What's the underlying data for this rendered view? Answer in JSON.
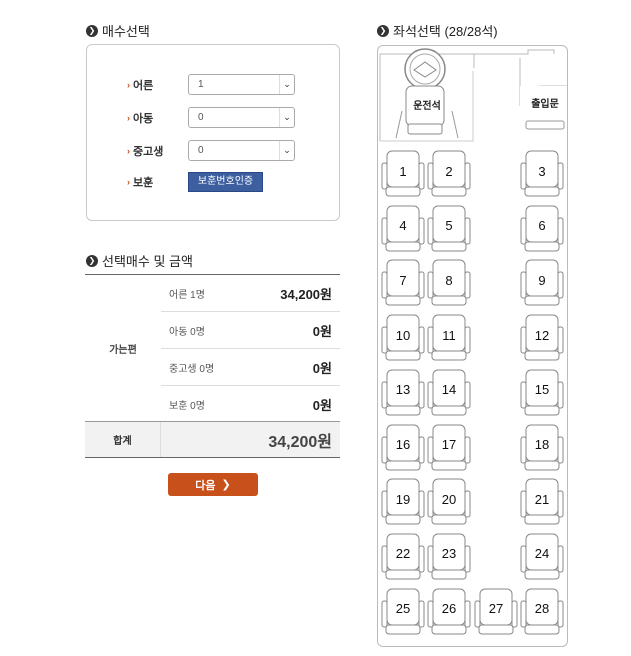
{
  "count_section": {
    "title": "매수선택",
    "rows": [
      {
        "label": "어른",
        "value": "1",
        "type": "select"
      },
      {
        "label": "아동",
        "value": "0",
        "type": "select"
      },
      {
        "label": "중고생",
        "value": "0",
        "type": "select"
      },
      {
        "label": "보훈",
        "button": "보훈번호인증",
        "type": "button"
      }
    ]
  },
  "summary_section": {
    "title": "선택매수 및 금액",
    "route": "가는편",
    "rows": [
      {
        "label": "어른 1명",
        "amount": "34,200원"
      },
      {
        "label": "아동 0명",
        "amount": "0원"
      },
      {
        "label": "중고생 0명",
        "amount": "0원"
      },
      {
        "label": "보훈 0명",
        "amount": "0원"
      }
    ],
    "total_label": "합계",
    "total_amount": "34,200원"
  },
  "next_button": "다음",
  "seat_section": {
    "title": "좌석선택 (28/28석)",
    "driver_label": "운전석",
    "door_label": "출입문",
    "seats": [
      "1",
      "2",
      "3",
      "4",
      "5",
      "6",
      "7",
      "8",
      "9",
      "10",
      "11",
      "12",
      "13",
      "14",
      "15",
      "16",
      "17",
      "18",
      "19",
      "20",
      "21",
      "22",
      "23",
      "24",
      "25",
      "26",
      "27",
      "28"
    ]
  }
}
